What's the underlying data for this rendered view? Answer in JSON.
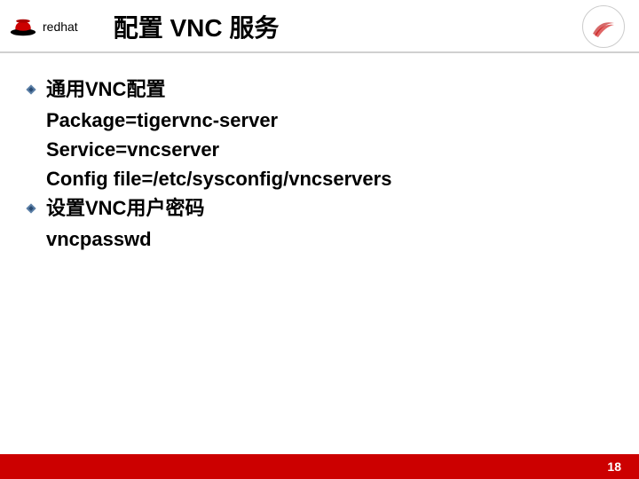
{
  "header": {
    "brand": "redhat",
    "title": "配置 VNC 服务"
  },
  "content": {
    "bullets": [
      {
        "heading": "通用VNC配置",
        "lines": [
          "Package=tigervnc-server",
          "Service=vncserver",
          "Config file=/etc/sysconfig/vncservers"
        ]
      },
      {
        "heading": "设置VNC用户密码",
        "lines": [
          "vncpasswd"
        ]
      }
    ]
  },
  "footer": {
    "page": "18"
  }
}
